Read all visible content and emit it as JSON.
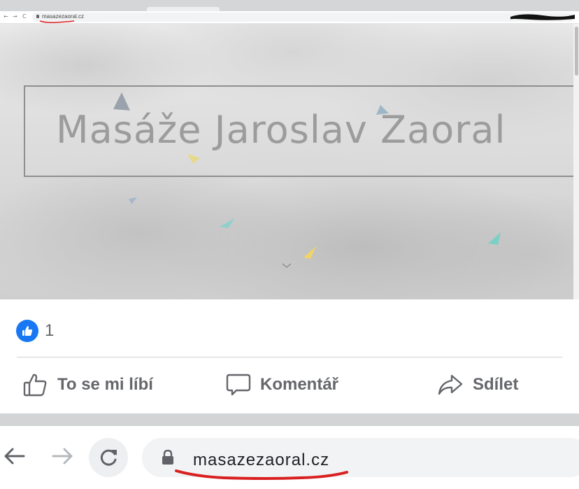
{
  "mini_browser": {
    "back": "←",
    "forward": "→",
    "reload": "C",
    "url": "masazezaoral.cz"
  },
  "site": {
    "title": "Masáže Jaroslav Zaoral"
  },
  "post": {
    "like_count": "1",
    "actions": {
      "like": "To se mi líbí",
      "comment": "Komentář",
      "share": "Sdílet"
    }
  },
  "browser": {
    "url": "masazezaoral.cz"
  },
  "colors": {
    "facebook_blue": "#1877f2",
    "action_gray": "#65676b",
    "annotation_red": "#d92020"
  }
}
